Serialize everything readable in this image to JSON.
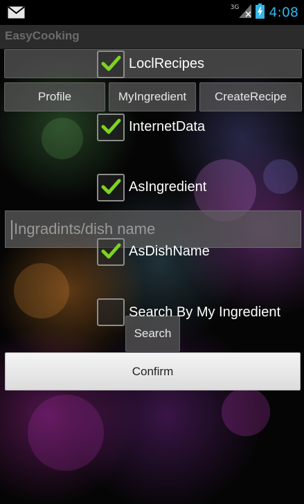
{
  "status_bar": {
    "network_label": "3G",
    "time": "4:08",
    "icons": [
      "mail-icon",
      "signal-icon",
      "battery-charging-icon"
    ]
  },
  "app_title": "EasyCooking",
  "buttons": {
    "profile": "Profile",
    "my_ingredient": "MyIngredient",
    "create_recipe": "CreateRecipe",
    "search": "Search",
    "confirm": "Confirm"
  },
  "checkboxes": {
    "local_recipes": {
      "label": "LoclRecipes",
      "checked": true
    },
    "internet_data": {
      "label": "InternetData",
      "checked": true
    },
    "as_ingredient": {
      "label": "AsIngredient",
      "checked": true
    },
    "as_dish_name": {
      "label": "AsDishName",
      "checked": true
    },
    "search_by_my_ingredient": {
      "label": "Search By My Ingredient",
      "checked": false
    }
  },
  "search_field": {
    "placeholder": "Ingradints/dish name",
    "value": ""
  },
  "colors": {
    "accent": "#33b5e5",
    "checkmark": "#7ed321",
    "title_bar": "#2b2b2b"
  }
}
